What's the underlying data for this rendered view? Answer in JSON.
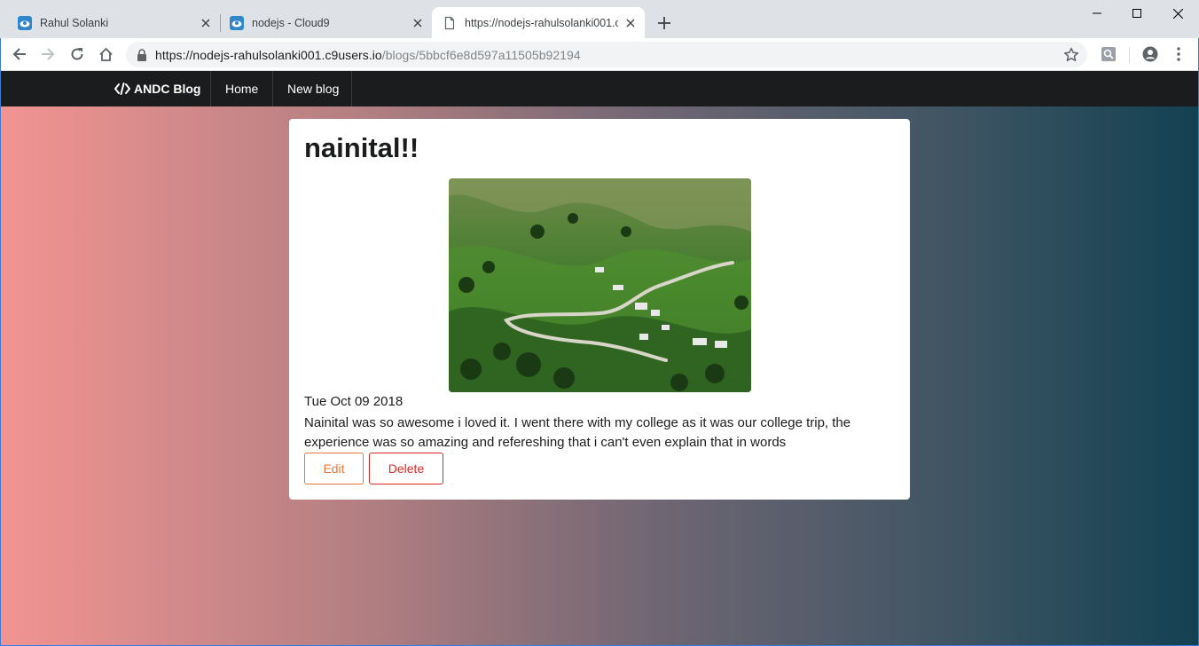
{
  "browser": {
    "tabs": [
      {
        "title": "Rahul Solanki",
        "favicon": "cloud9-icon",
        "active": false
      },
      {
        "title": "nodejs - Cloud9",
        "favicon": "cloud9-icon",
        "active": false
      },
      {
        "title": "https://nodejs-rahulsolanki001.c9",
        "favicon": "page-icon",
        "active": true
      }
    ],
    "address": {
      "host": "https://nodejs-rahulsolanki001.c9users.io",
      "path": "/blogs/5bbcf6e8d597a11505b92194"
    },
    "colors": {
      "tabstrip": "#dee1e6",
      "omnibox": "#f1f3f4",
      "active_tab": "#ffffff"
    }
  },
  "navbar": {
    "brand": "ANDC Blog",
    "brand_icon": "code-icon",
    "links": [
      "Home",
      "New blog"
    ],
    "background": "#1b1c1d"
  },
  "post": {
    "title": "nainital!!",
    "image_alt": "hillside-road-photo",
    "date": "Tue Oct 09 2018",
    "body": "Nainital was so awesome i loved it. I went there with my college as it was our college trip, the experience was so amazing and refereshing that i can't even explain that in words",
    "edit_label": "Edit",
    "delete_label": "Delete",
    "edit_color": "#e0793a",
    "delete_color": "#db2828"
  },
  "page_gradient": [
    "#f29492",
    "#134152"
  ]
}
